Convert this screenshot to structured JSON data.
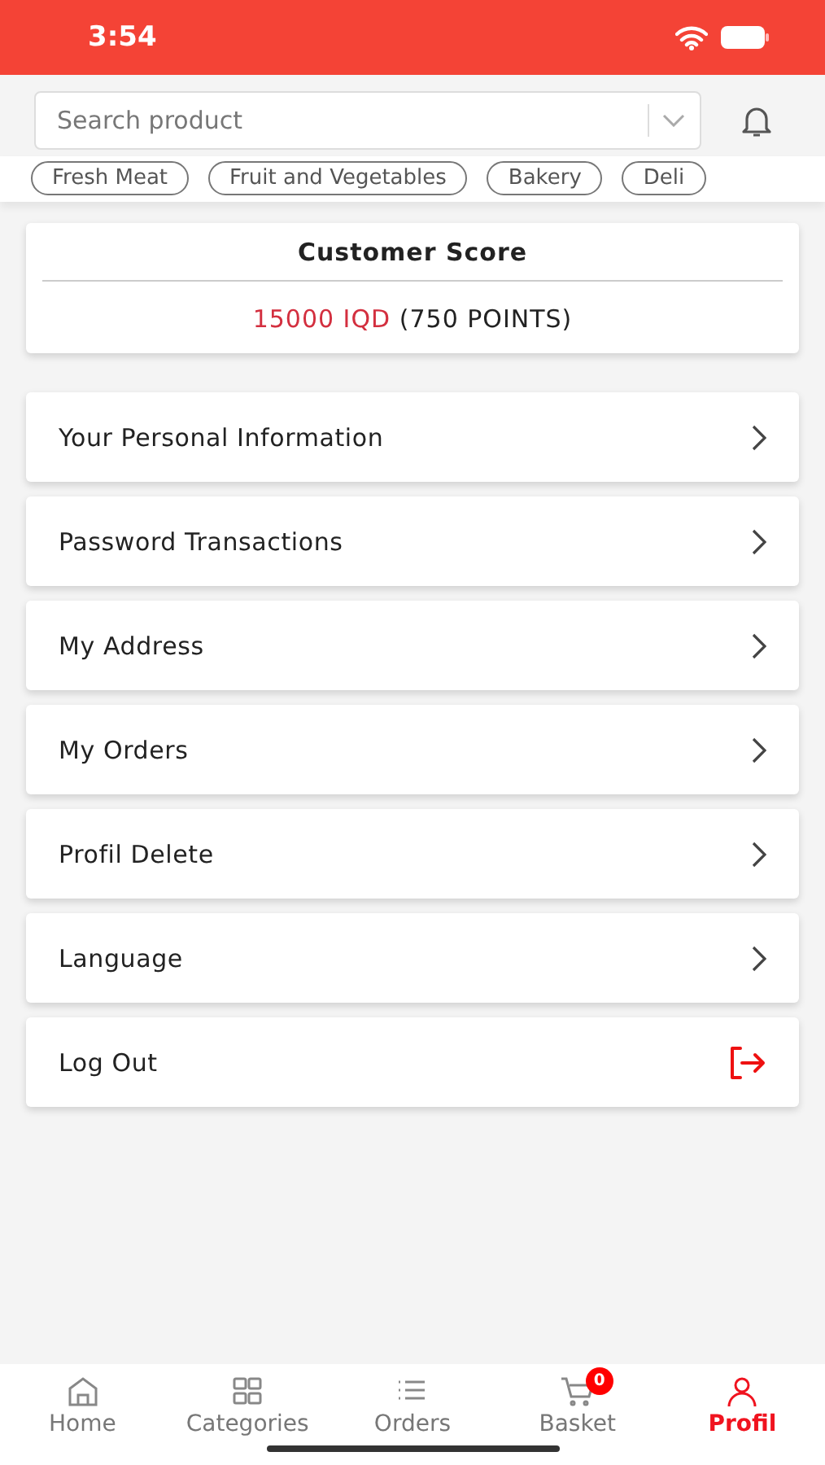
{
  "status_bar": {
    "time": "3:54"
  },
  "search": {
    "placeholder": "Search product"
  },
  "categories": [
    {
      "label": "Fresh Meat"
    },
    {
      "label": "Fruit and Vegetables"
    },
    {
      "label": "Bakery"
    },
    {
      "label": "Deli"
    }
  ],
  "score_card": {
    "title": "Customer Score",
    "amount": "15000 IQD",
    "points": "(750 POINTS)"
  },
  "menu": [
    {
      "label": "Your Personal Information",
      "kind": "chevron"
    },
    {
      "label": "Password Transactions",
      "kind": "chevron"
    },
    {
      "label": "My Address",
      "kind": "chevron"
    },
    {
      "label": "My Orders",
      "kind": "chevron"
    },
    {
      "label": "Profil Delete",
      "kind": "chevron"
    },
    {
      "label": "Language",
      "kind": "chevron"
    },
    {
      "label": "Log Out",
      "kind": "logout"
    }
  ],
  "tab_bar": [
    {
      "label": "Home",
      "kind": "home",
      "selected": false
    },
    {
      "label": "Categories",
      "kind": "grid",
      "selected": false
    },
    {
      "label": "Orders",
      "kind": "list",
      "selected": false
    },
    {
      "label": "Basket",
      "kind": "cart",
      "selected": false,
      "badge": "0"
    },
    {
      "label": "Profil",
      "kind": "person",
      "selected": true
    }
  ]
}
